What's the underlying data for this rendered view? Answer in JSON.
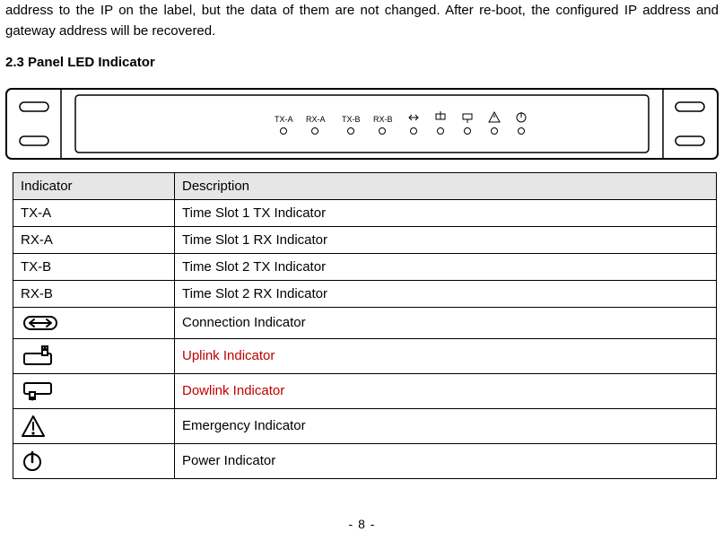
{
  "paragraph": "address to the IP on the label, but the data of them are not changed. After re-boot, the configured IP address and gateway address will be recovered.",
  "heading": "2.3  Panel LED Indicator",
  "panel_labels": {
    "txa": "TX-A",
    "rxa": "RX-A",
    "txb": "TX-B",
    "rxb": "RX-B"
  },
  "table": {
    "head": {
      "indicator": "Indicator",
      "description": "Description"
    },
    "rows": [
      {
        "indicator": "TX-A",
        "description": "Time Slot 1 TX Indicator",
        "red": false,
        "icon": null
      },
      {
        "indicator": "RX-A",
        "description": "Time Slot 1 RX Indicator",
        "red": false,
        "icon": null
      },
      {
        "indicator": "TX-B",
        "description": "Time Slot 2 TX Indicator",
        "red": false,
        "icon": null
      },
      {
        "indicator": "RX-B",
        "description": "Time Slot 2 RX Indicator",
        "red": false,
        "icon": null
      },
      {
        "indicator": "",
        "description": "Connection Indicator",
        "red": false,
        "icon": "connection"
      },
      {
        "indicator": "",
        "description": "Uplink Indicator",
        "red": true,
        "icon": "uplink"
      },
      {
        "indicator": "",
        "description": "Dowlink Indicator",
        "red": true,
        "icon": "downlink"
      },
      {
        "indicator": "",
        "description": "Emergency Indicator",
        "red": false,
        "icon": "emergency"
      },
      {
        "indicator": "",
        "description": "Power Indicator",
        "red": false,
        "icon": "power"
      }
    ]
  },
  "page_number": "-  8  -"
}
